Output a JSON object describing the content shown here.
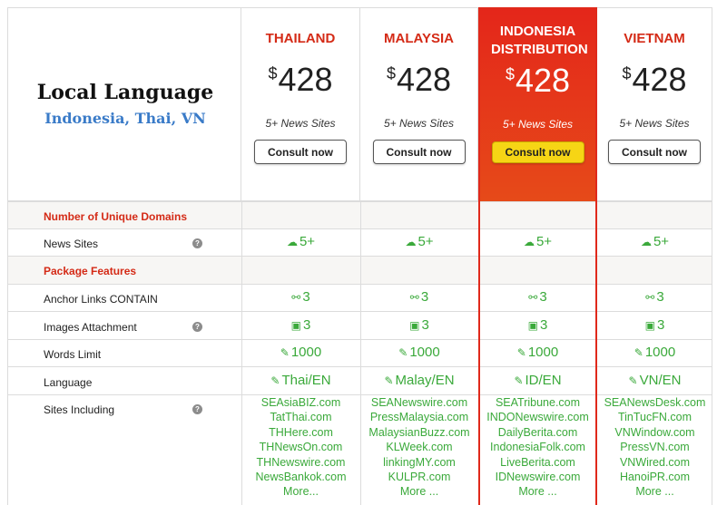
{
  "header": {
    "title": "Local Language",
    "subtitle": "Indonesia, Thai, VN"
  },
  "plans": [
    {
      "name": "THAILAND",
      "currency": "$",
      "price": "428",
      "sites": "5+ News Sites",
      "button": "Consult now"
    },
    {
      "name": "MALAYSIA",
      "currency": "$",
      "price": "428",
      "sites": "5+ News Sites",
      "button": "Consult now"
    },
    {
      "name": "INDONESIA DISTRIBUTION",
      "currency": "$",
      "price": "428",
      "sites": "5+ News Sites",
      "button": "Consult now"
    },
    {
      "name": "VIETNAM",
      "currency": "$",
      "price": "428",
      "sites": "5+ News Sites",
      "button": "Consult now"
    }
  ],
  "sections": {
    "domains": "Number of Unique Domains",
    "features": "Package Features"
  },
  "rows": {
    "news_sites": {
      "label": "News Sites",
      "values": [
        "5+",
        "5+",
        "5+",
        "5+"
      ]
    },
    "anchor": {
      "label": "Anchor Links CONTAIN",
      "values": [
        "3",
        "3",
        "3",
        "3"
      ]
    },
    "images": {
      "label": "Images Attachment",
      "values": [
        "3",
        "3",
        "3",
        "3"
      ]
    },
    "words": {
      "label": "Words Limit",
      "values": [
        "1000",
        "1000",
        "1000",
        "1000"
      ]
    },
    "language": {
      "label": "Language",
      "values": [
        "Thai/EN",
        "Malay/EN",
        "ID/EN",
        "VN/EN"
      ]
    },
    "sites": {
      "label": "Sites Including"
    }
  },
  "site_lists": [
    [
      "SEAsiaBIZ.com",
      "TatThai.com",
      "THHere.com",
      "THNewsOn.com",
      "THNewswire.com",
      "NewsBankok.com",
      "More..."
    ],
    [
      "SEANewswire.com",
      "PressMalaysia.com",
      "MalaysianBuzz.com",
      "KLWeek.com",
      "linkingMY.com",
      "KULPR.com",
      "More ..."
    ],
    [
      "SEATribune.com",
      "INDONewswire.com",
      "DailyBerita.com",
      "IndonesiaFolk.com",
      "LiveBerita.com",
      "IDNewswire.com",
      "More ..."
    ],
    [
      "SEANewsDesk.com",
      "TinTucFN.com",
      "VNWindow.com",
      "PressVN.com",
      "VNWired.com",
      "HanoiPR.com",
      "More ..."
    ]
  ],
  "icons": {
    "cloud": "cloud-icon",
    "link": "link-icon",
    "image": "image-icon",
    "pencil": "pencil-icon",
    "help": "question-icon"
  },
  "colors": {
    "accent_red": "#d42a16",
    "green": "#3aa93a",
    "highlight_button": "#f6d515",
    "subtitle_blue": "#3a7bc8"
  }
}
